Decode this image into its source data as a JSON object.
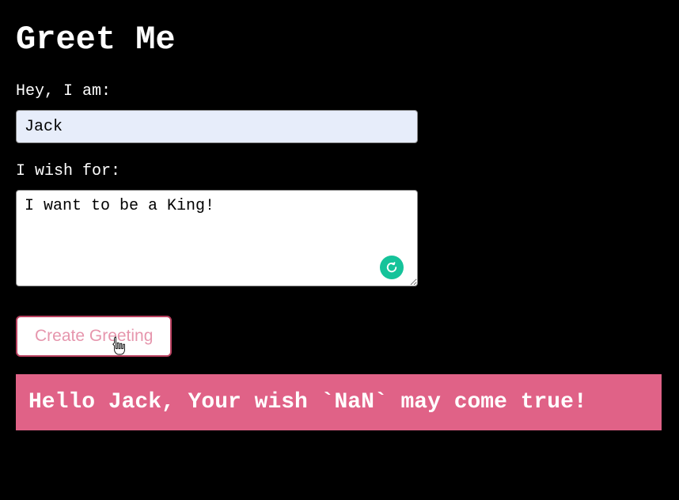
{
  "title": "Greet Me",
  "form": {
    "name_label": "Hey, I am:",
    "name_value": "Jack",
    "wish_label": "I wish for:",
    "wish_value": "I want to be a King!"
  },
  "button": {
    "create_label": "Create Greeting"
  },
  "output": {
    "greeting": "Hello Jack, Your wish `NaN` may come true!"
  },
  "icons": {
    "grammarly": "grammarly-icon",
    "cursor": "pointer-cursor"
  }
}
